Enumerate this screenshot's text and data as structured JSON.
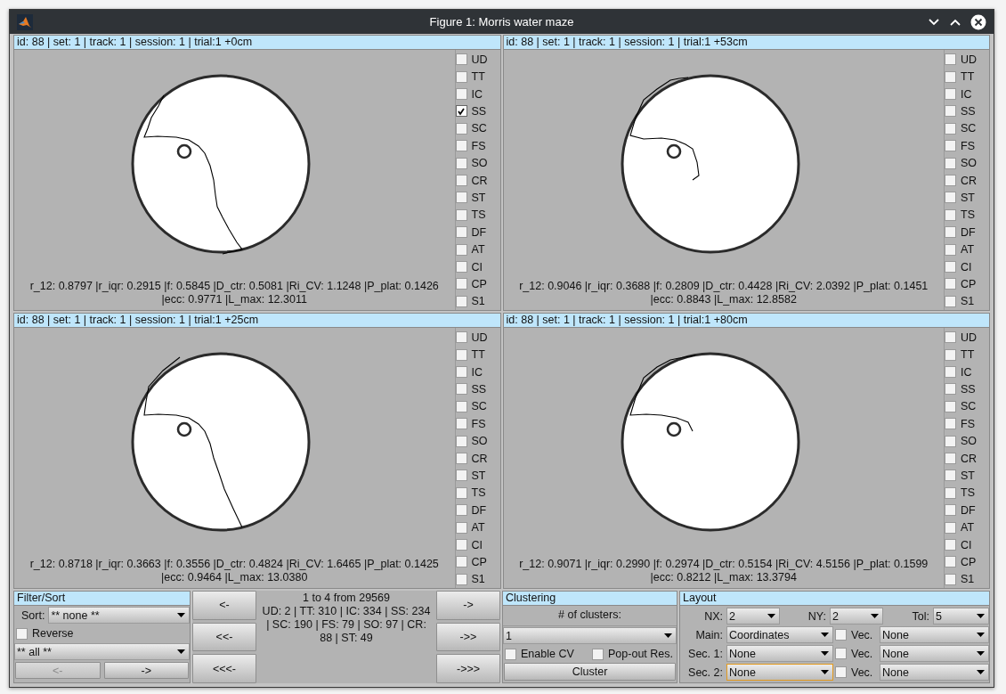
{
  "window": {
    "title": "Figure 1: Morris water maze"
  },
  "panels": [
    {
      "header": "id: 88 | set: 1 | track: 1 | session: 1 | trial:1 +0cm",
      "stats": [
        "r_12: 0.8797 |r_iqr: 0.2915 |f: 0.5845 |D_ctr: 0.5081 |Ri_CV: 1.1248 |P_plat: 0.1426",
        "|ecc: 0.9771 |L_max: 12.3011"
      ],
      "categories": [
        {
          "label": "UD",
          "checked": false
        },
        {
          "label": "TT",
          "checked": false
        },
        {
          "label": "IC",
          "checked": false
        },
        {
          "label": "SS",
          "checked": true
        },
        {
          "label": "SC",
          "checked": false
        },
        {
          "label": "FS",
          "checked": false
        },
        {
          "label": "SO",
          "checked": false
        },
        {
          "label": "CR",
          "checked": false
        },
        {
          "label": "ST",
          "checked": false
        },
        {
          "label": "TS",
          "checked": false
        },
        {
          "label": "DF",
          "checked": false
        },
        {
          "label": "AT",
          "checked": false
        },
        {
          "label": "CI",
          "checked": false
        },
        {
          "label": "CP",
          "checked": false
        },
        {
          "label": "S1",
          "checked": false
        }
      ]
    },
    {
      "header": "id: 88 | set: 1 | track: 1 | session: 1 | trial:1 +53cm",
      "stats": [
        "r_12: 0.9046 |r_iqr: 0.3688 |f: 0.2809 |D_ctr: 0.4428 |Ri_CV: 2.0392 |P_plat: 0.1451",
        "|ecc: 0.8843 |L_max: 12.8582"
      ],
      "categories": [
        {
          "label": "UD",
          "checked": false
        },
        {
          "label": "TT",
          "checked": false
        },
        {
          "label": "IC",
          "checked": false
        },
        {
          "label": "SS",
          "checked": false
        },
        {
          "label": "SC",
          "checked": false
        },
        {
          "label": "FS",
          "checked": false
        },
        {
          "label": "SO",
          "checked": false
        },
        {
          "label": "CR",
          "checked": false
        },
        {
          "label": "ST",
          "checked": false
        },
        {
          "label": "TS",
          "checked": false
        },
        {
          "label": "DF",
          "checked": false
        },
        {
          "label": "AT",
          "checked": false
        },
        {
          "label": "CI",
          "checked": false
        },
        {
          "label": "CP",
          "checked": false
        },
        {
          "label": "S1",
          "checked": false
        }
      ]
    },
    {
      "header": "id: 88 | set: 1 | track: 1 | session: 1 | trial:1 +25cm",
      "stats": [
        "r_12: 0.8718 |r_iqr: 0.3663 |f: 0.3556 |D_ctr: 0.4824 |Ri_CV: 1.6465 |P_plat: 0.1425",
        "|ecc: 0.9464 |L_max: 13.0380"
      ],
      "categories": [
        {
          "label": "UD",
          "checked": false
        },
        {
          "label": "TT",
          "checked": false
        },
        {
          "label": "IC",
          "checked": false
        },
        {
          "label": "SS",
          "checked": false
        },
        {
          "label": "SC",
          "checked": false
        },
        {
          "label": "FS",
          "checked": false
        },
        {
          "label": "SO",
          "checked": false
        },
        {
          "label": "CR",
          "checked": false
        },
        {
          "label": "ST",
          "checked": false
        },
        {
          "label": "TS",
          "checked": false
        },
        {
          "label": "DF",
          "checked": false
        },
        {
          "label": "AT",
          "checked": false
        },
        {
          "label": "CI",
          "checked": false
        },
        {
          "label": "CP",
          "checked": false
        },
        {
          "label": "S1",
          "checked": false
        }
      ]
    },
    {
      "header": "id: 88 | set: 1 | track: 1 | session: 1 | trial:1 +80cm",
      "stats": [
        "r_12: 0.9071 |r_iqr: 0.2990 |f: 0.2974 |D_ctr: 0.5154 |Ri_CV: 4.5156 |P_plat: 0.1599",
        "|ecc: 0.8212 |L_max: 13.3794"
      ],
      "categories": [
        {
          "label": "UD",
          "checked": false
        },
        {
          "label": "TT",
          "checked": false
        },
        {
          "label": "IC",
          "checked": false
        },
        {
          "label": "SS",
          "checked": false
        },
        {
          "label": "SC",
          "checked": false
        },
        {
          "label": "FS",
          "checked": false
        },
        {
          "label": "SO",
          "checked": false
        },
        {
          "label": "CR",
          "checked": false
        },
        {
          "label": "ST",
          "checked": false
        },
        {
          "label": "TS",
          "checked": false
        },
        {
          "label": "DF",
          "checked": false
        },
        {
          "label": "AT",
          "checked": false
        },
        {
          "label": "CI",
          "checked": false
        },
        {
          "label": "CP",
          "checked": false
        },
        {
          "label": "S1",
          "checked": false
        }
      ]
    }
  ],
  "filter_sort": {
    "title": "Filter/Sort",
    "sort_label": "Sort:",
    "sort_value": "** none **",
    "reverse": {
      "label": "Reverse",
      "checked": false
    },
    "filter_value": "** all **",
    "buttons": [
      {
        "label": "<-",
        "disabled": true
      },
      {
        "label": "->",
        "disabled": false
      }
    ]
  },
  "navigation": {
    "back_buttons": [
      "<-",
      "<<-",
      "<<<-"
    ],
    "summary": "1 to 4 from 29569",
    "counts": "UD: 2 | TT: 310 | IC: 334 | SS: 234 | SC: 190 | FS: 79 | SO: 97 | CR: 88 | ST: 49",
    "forward_buttons": [
      "->",
      "->>",
      "->>>"
    ]
  },
  "clustering": {
    "title": "Clustering",
    "clusters_label": "# of clusters:",
    "clusters_value": "1",
    "options": [
      {
        "label": "Enable CV",
        "checked": false
      },
      {
        "label": "Pop-out Res.",
        "checked": false
      }
    ],
    "button": "Cluster"
  },
  "layout": {
    "title": "Layout",
    "grid": [
      {
        "label": "NX:",
        "value": "2"
      },
      {
        "label": "NY:",
        "value": "2"
      },
      {
        "label": "Tol:",
        "value": "5"
      }
    ],
    "rows": [
      {
        "label": "Main:",
        "value": "Coordinates",
        "focused": false,
        "vec": {
          "label": "Vec.",
          "checked": false
        },
        "vec_value": "None"
      },
      {
        "label": "Sec. 1:",
        "value": "None",
        "focused": false,
        "vec": {
          "label": "Vec.",
          "checked": false
        },
        "vec_value": "None"
      },
      {
        "label": "Sec. 2:",
        "value": "None",
        "focused": true,
        "vec": {
          "label": "Vec.",
          "checked": false
        },
        "vec_value": "None"
      }
    ]
  }
}
